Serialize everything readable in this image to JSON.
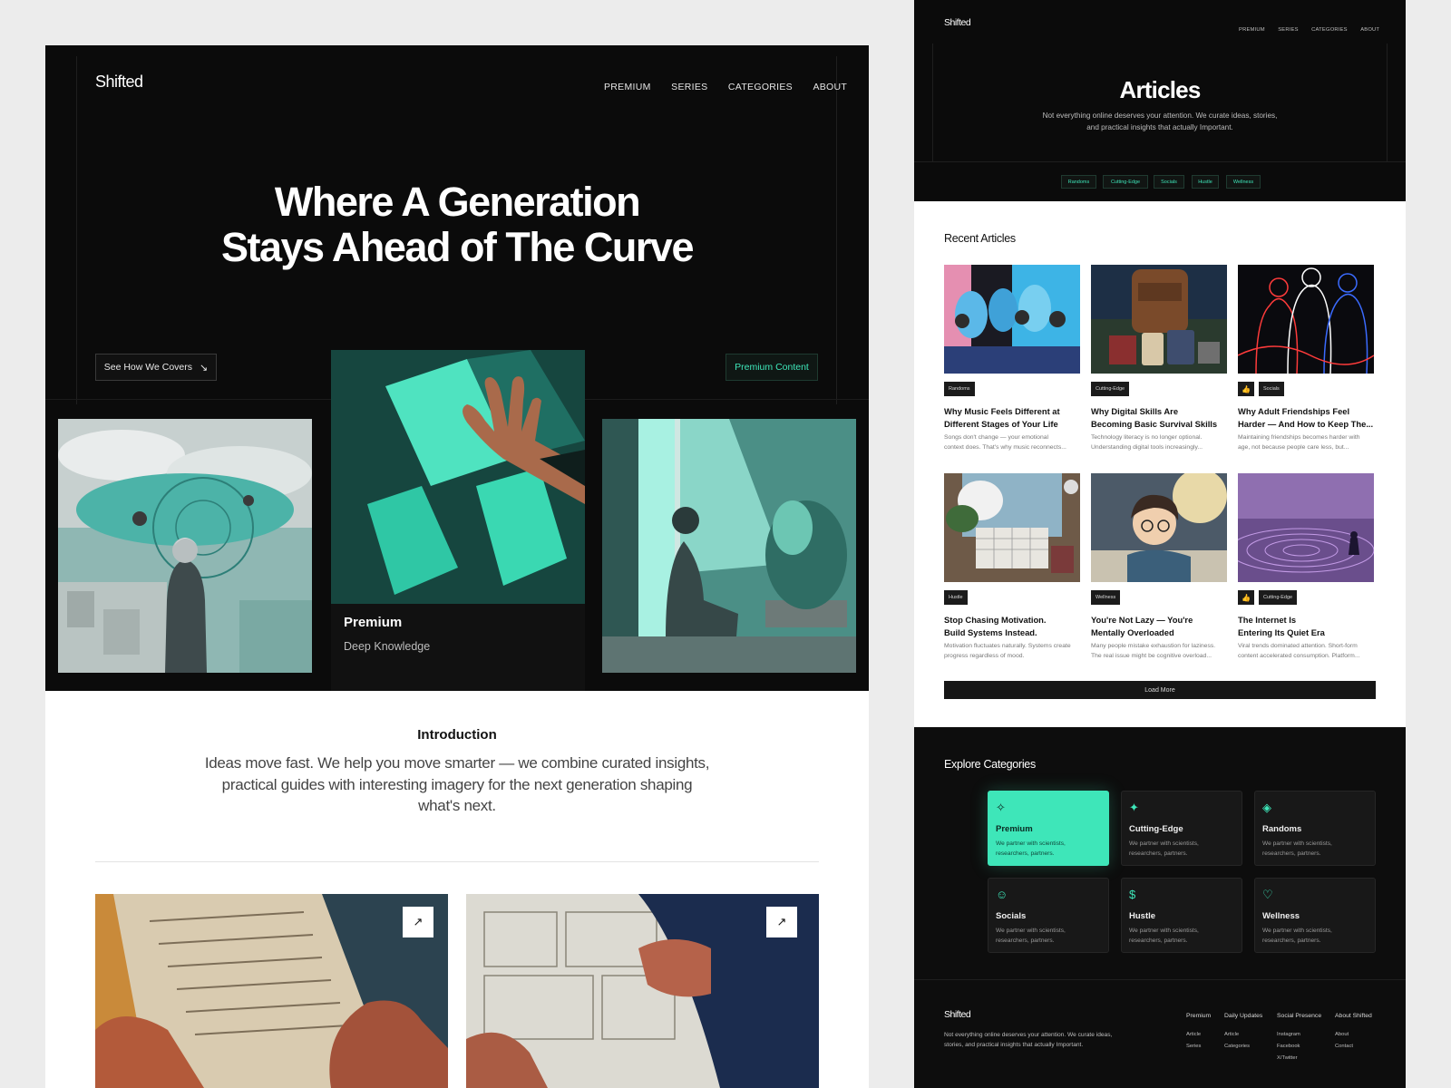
{
  "left": {
    "brand": "Shifted",
    "nav": [
      "PREMIUM",
      "SERIES",
      "CATEGORIES",
      "ABOUT"
    ],
    "hero_line1": "Where A Generation",
    "hero_line2": "Stays Ahead of The Curve",
    "cta_outline": "See How We Covers",
    "cta_outline_icon": "arrow-down-right-icon",
    "cta_green": "Premium Content",
    "feature_title": "Premium",
    "feature_subtitle": "Deep Knowledge",
    "intro_heading": "Introduction",
    "intro_text": "Ideas move fast. We help you move smarter — we combine curated insights, practical guides with interesting imagery for the next generation shaping what's next.",
    "card_arrow_icon": "arrow-up-right-icon"
  },
  "right": {
    "brand": "Shifted",
    "nav": [
      "PREMIUM",
      "SERIES",
      "CATEGORIES",
      "ABOUT"
    ],
    "page_title": "Articles",
    "page_subtitle_1": "Not everything online deserves your attention. We curate ideas, stories,",
    "page_subtitle_2": "and practical insights that actually Important.",
    "chips": [
      "Randoms",
      "Cutting-Edge",
      "Socials",
      "Hustle",
      "Wellness"
    ],
    "recent_heading": "Recent Articles",
    "articles": [
      {
        "tag": "Randoms",
        "thumb": false,
        "title1": "Why Music Feels Different at",
        "title2": "Different Stages of Your Life",
        "desc1": "Songs don't change — your emotional",
        "desc2": "context does. That's why music reconnects..."
      },
      {
        "tag": "Cutting-Edge",
        "thumb": false,
        "title1": "Why Digital Skills Are",
        "title2": "Becoming Basic Survival Skills",
        "desc1": "Technology literacy is no longer optional.",
        "desc2": "Understanding digital tools increasingly..."
      },
      {
        "tag": "Socials",
        "thumb": true,
        "title1": "Why Adult Friendships Feel",
        "title2": "Harder — And How to Keep The...",
        "desc1": "Maintaining friendships becomes harder with",
        "desc2": "age, not because people care less, but..."
      },
      {
        "tag": "Hustle",
        "thumb": false,
        "title1": "Stop Chasing Motivation.",
        "title2": "Build Systems Instead.",
        "desc1": "Motivation fluctuates naturally. Systems create",
        "desc2": "progress regardless of mood."
      },
      {
        "tag": "Wellness",
        "thumb": false,
        "title1": "You're Not Lazy — You're",
        "title2": "Mentally Overloaded",
        "desc1": "Many people mistake exhaustion for laziness.",
        "desc2": "The real issue might be cognitive overload..."
      },
      {
        "tag": "Cutting-Edge",
        "thumb": true,
        "title1": "The Internet Is",
        "title2": "Entering Its Quiet Era",
        "desc1": "Viral trends dominated attention. Short-form",
        "desc2": "content accelerated consumption. Platform..."
      }
    ],
    "thumb_icon": "thumbs-up-icon",
    "load_more": "Load More",
    "explore_heading": "Explore Categories",
    "categories": [
      {
        "name": "Premium",
        "icon": "sparkle-icon",
        "glyph": "✧",
        "desc1": "We partner with scientists,",
        "desc2": "researchers, partners."
      },
      {
        "name": "Cutting-Edge",
        "icon": "sparkle-icon",
        "glyph": "✦",
        "desc1": "We partner with scientists,",
        "desc2": "researchers, partners."
      },
      {
        "name": "Randoms",
        "icon": "layers-icon",
        "glyph": "◈",
        "desc1": "We partner with scientists,",
        "desc2": "researchers, partners."
      },
      {
        "name": "Socials",
        "icon": "users-icon",
        "glyph": "☺",
        "desc1": "We partner with scientists,",
        "desc2": "researchers, partners."
      },
      {
        "name": "Hustle",
        "icon": "dollar-icon",
        "glyph": "$",
        "desc1": "We partner with scientists,",
        "desc2": "researchers, partners."
      },
      {
        "name": "Wellness",
        "icon": "heart-icon",
        "glyph": "♡",
        "desc1": "We partner with scientists,",
        "desc2": "researchers, partners."
      }
    ],
    "footer": {
      "brand": "Shifted",
      "text1": "Not everything online deserves your attention. We curate ideas,",
      "text2": "stories, and practical insights that actually Important.",
      "columns": [
        {
          "heading": "Premium",
          "links": [
            "Article",
            "Series"
          ]
        },
        {
          "heading": "Daily Updates",
          "links": [
            "Article",
            "Categories"
          ]
        },
        {
          "heading": "Social Presence",
          "links": [
            "Instagram",
            "Facebook",
            "X/Twitter"
          ]
        },
        {
          "heading": "About Shifted",
          "links": [
            "About",
            "Contact"
          ]
        }
      ]
    }
  },
  "colors": {
    "accent": "#3ee6b9",
    "dark": "#0b0b0b",
    "card": "#181818"
  }
}
